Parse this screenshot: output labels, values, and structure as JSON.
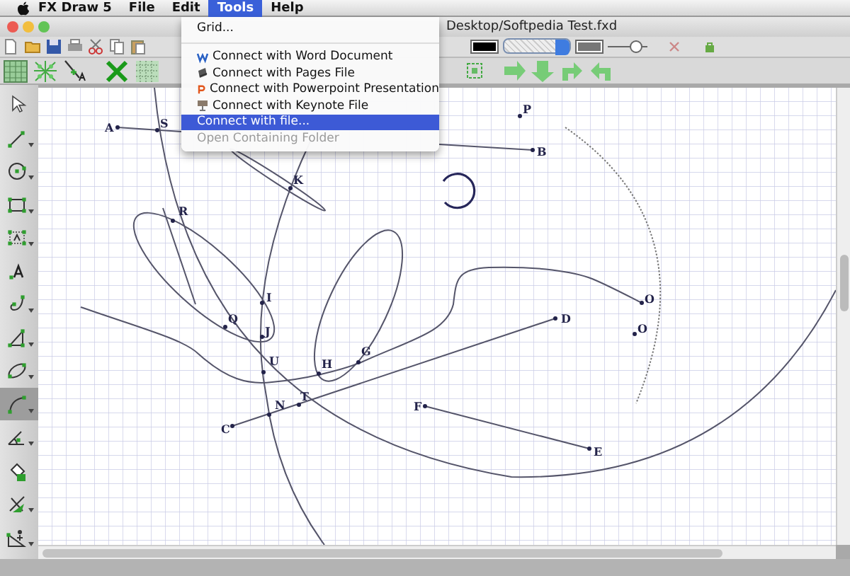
{
  "menu_bar": {
    "items": [
      {
        "label": "FX Draw 5",
        "selected": false
      },
      {
        "label": "File",
        "selected": false
      },
      {
        "label": "Edit",
        "selected": false
      },
      {
        "label": "Tools",
        "selected": true
      },
      {
        "label": "Help",
        "selected": false
      }
    ]
  },
  "toolbar": {
    "line_width": {
      "level": 0.8
    }
  },
  "window": {
    "title": "Desktop/Softpedia Test.fxd"
  },
  "tools_menu": {
    "items": [
      {
        "kind": "item",
        "label": "Grid...",
        "selected": false,
        "disabled": false
      },
      {
        "kind": "separator"
      },
      {
        "kind": "connect",
        "label": "Connect with Word Document",
        "selected": false,
        "disabled": false
      },
      {
        "kind": "connect",
        "label": "Connect with Pages File",
        "selected": false,
        "disabled": false
      },
      {
        "kind": "connect",
        "label": "Connect with Powerpoint Presentation",
        "selected": false,
        "disabled": false
      },
      {
        "kind": "connect",
        "label": "Connect with Keynote File",
        "selected": false,
        "disabled": false
      },
      {
        "kind": "item",
        "label": "Connect with file...",
        "selected": true,
        "disabled": false
      },
      {
        "kind": "item",
        "label": "Open Containing Folder",
        "selected": false,
        "disabled": true
      }
    ]
  },
  "tool_palette": {
    "tools": [
      {
        "selected": false,
        "has_menu": false
      },
      {
        "selected": false,
        "has_menu": true
      },
      {
        "selected": false,
        "has_menu": true
      },
      {
        "selected": false,
        "has_menu": true
      },
      {
        "selected": false,
        "has_menu": true
      },
      {
        "selected": false,
        "has_menu": false
      },
      {
        "selected": false,
        "has_menu": true
      },
      {
        "selected": false,
        "has_menu": true
      },
      {
        "selected": false,
        "has_menu": true
      },
      {
        "selected": true,
        "has_menu": true
      },
      {
        "selected": false,
        "has_menu": true
      },
      {
        "selected": false,
        "has_menu": false
      },
      {
        "selected": false,
        "has_menu": true
      },
      {
        "selected": false,
        "has_menu": true
      }
    ]
  },
  "canvas": {
    "points": [
      {
        "label": "P"
      },
      {
        "label": "A"
      },
      {
        "label": "S"
      },
      {
        "label": "B"
      },
      {
        "label": "K"
      },
      {
        "label": "R"
      },
      {
        "label": "I"
      },
      {
        "label": "Q"
      },
      {
        "label": "J"
      },
      {
        "label": "D"
      },
      {
        "label": "O"
      },
      {
        "label": "O"
      },
      {
        "label": "U"
      },
      {
        "label": "H"
      },
      {
        "label": "G"
      },
      {
        "label": "T"
      },
      {
        "label": "N"
      },
      {
        "label": "C"
      },
      {
        "label": "F"
      },
      {
        "label": "E"
      }
    ]
  }
}
